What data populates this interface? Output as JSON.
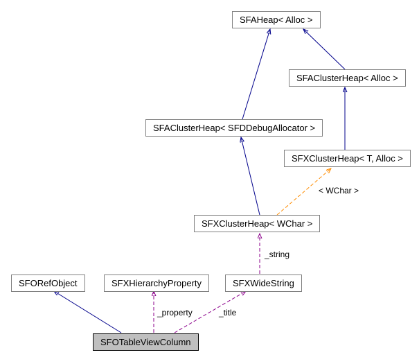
{
  "nodes": {
    "sfaheap": {
      "label": "SFAHeap< Alloc >"
    },
    "sfaclusterheap_alloc": {
      "label": "SFAClusterHeap< Alloc >"
    },
    "sfaclusterheap_debug": {
      "label": "SFAClusterHeap< SFDDebugAllocator >"
    },
    "sfxclusterheap_talloc": {
      "label": "SFXClusterHeap< T, Alloc >"
    },
    "sfxclusterheap_wchar": {
      "label": "SFXClusterHeap< WChar >"
    },
    "sforefobject": {
      "label": "SFORefObject"
    },
    "sfxhierarchy": {
      "label": "SFXHierarchyProperty"
    },
    "sfxwidestring": {
      "label": "SFXWideString"
    },
    "sfotableviewcolumn": {
      "label": "SFOTableViewColumn"
    }
  },
  "edge_labels": {
    "wchar_template": "< WChar >",
    "string_member": "_string",
    "property_member": "_property",
    "title_member": "_title"
  }
}
